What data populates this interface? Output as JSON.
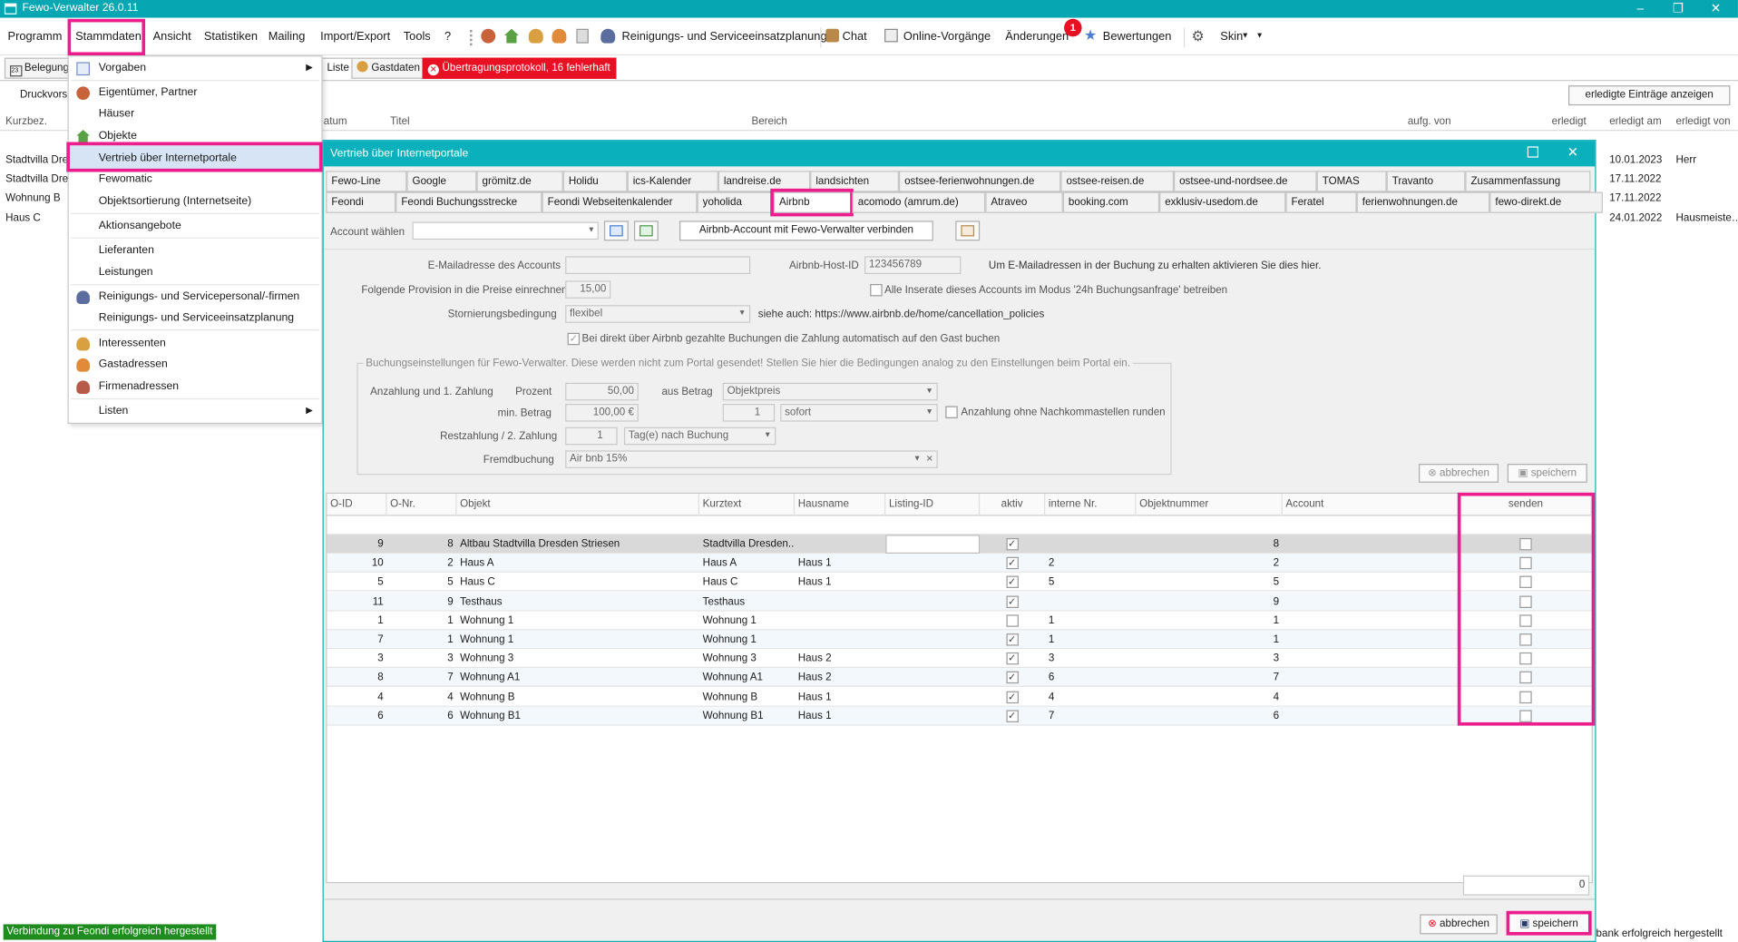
{
  "app": {
    "title": "Fewo-Verwalter 26.0.11",
    "window_controls": [
      "–",
      "❐",
      "✕"
    ]
  },
  "menu": {
    "items": [
      "Programm",
      "Stammdaten",
      "Ansicht",
      "Statistiken",
      "Mailing",
      "Import/Export",
      "Tools",
      "?"
    ],
    "reinigung": "Reinigungs- und Serviceeinsatzplanung",
    "chat": "Chat",
    "online": "Online-Vorgänge",
    "aenderungen": "Änderungen",
    "aenderungen_badge": "1",
    "bewertungen": "Bewertungen",
    "skin": "Skin"
  },
  "tabs": {
    "belegung": "Belegung",
    "liste": "Liste",
    "gastdaten": "Gastdaten",
    "protokoll": "Übertragungsprotokoll, 16 fehlerhaft"
  },
  "background": {
    "druckvorschau": "Druckvorsc",
    "erledigte_btn": "erledigte Einträge anzeigen",
    "headers": [
      "Kurzbez.",
      "atum",
      "Titel",
      "Bereich",
      "aufg. von",
      "erledigt",
      "erledigt am",
      "erledigt von"
    ],
    "rows_left": [
      "Stadtvilla Dres",
      "Stadtvilla Dres",
      "Wohnung B",
      "Haus C"
    ],
    "rows_right": [
      {
        "date": "10.01.2023",
        "by": "Herr"
      },
      {
        "date": "17.11.2022",
        "by": ""
      },
      {
        "date": "17.11.2022",
        "by": ""
      },
      {
        "date": "24.01.2022",
        "by": "Hausmeiste…"
      }
    ],
    "status_left": "Verbindung zu Feondi erfolgreich hergestellt",
    "status_right": "bank erfolgreich hergestellt"
  },
  "dropdown": {
    "items": [
      "Vorgaben",
      "Eigentümer, Partner",
      "Häuser",
      "Objekte",
      "Vertrieb über Internetportale",
      "Fewomatic",
      "Objektsortierung (Internetseite)",
      "Aktionsangebote",
      "Lieferanten",
      "Leistungen",
      "Reinigungs- und Servicepersonal/-firmen",
      "Reinigungs- und Serviceeinsatzplanung",
      "Interessenten",
      "Gastadressen",
      "Firmenadressen",
      "Listen"
    ]
  },
  "dialog": {
    "title": "Vertrieb über Internetportale",
    "portals_row1": [
      "Fewo-Line",
      "Google",
      "grömitz.de",
      "Holidu",
      "ics-Kalender",
      "landreise.de",
      "landsichten",
      "ostsee-ferienwohnungen.de",
      "ostsee-reisen.de",
      "ostsee-und-nordsee.de",
      "TOMAS",
      "Travanto",
      "Zusammenfassung"
    ],
    "portals_row2": [
      "Feondi",
      "Feondi Buchungsstrecke",
      "Feondi Webseitenkalender",
      "yoholida",
      "Airbnb",
      "acomodo (amrum.de)",
      "Atraveo",
      "booking.com",
      "exklusiv-usedom.de",
      "Feratel",
      "ferienwohnungen.de",
      "fewo-direkt.de"
    ],
    "account_label": "Account wählen",
    "account_value": "",
    "connect_btn": "Airbnb-Account mit Fewo-Verwalter verbinden",
    "email_label": "E-Mailadresse des Accounts",
    "email_value": "",
    "host_label": "Airbnb-Host-ID",
    "host_value": "123456789",
    "host_info": "Um E-Mailadressen in der Buchung zu erhalten aktivieren Sie dies hier.",
    "provision_label": "Folgende Provision in die Preise einrechnen",
    "provision_value": "15,00",
    "inserate_label": "Alle Inserate dieses Accounts im Modus '24h Buchungsanfrage' betreiben",
    "storno_label": "Stornierungsbedingung",
    "storno_value": "flexibel",
    "storno_info": "siehe auch: https://www.airbnb.de/home/cancellation_policies",
    "zahlung_label": "Bei direkt über Airbnb gezahlte Buchungen die Zahlung automatisch auf den Gast buchen",
    "group_label": "Buchungseinstellungen für Fewo-Verwalter. Diese werden nicht zum Portal gesendet! Stellen Sie hier die Bedingungen analog zu den Einstellungen beim Portal ein.",
    "anzahlung_label": "Anzahlung und 1. Zahlung",
    "prozent_label": "Prozent",
    "prozent_value": "50,00",
    "ausbetrag_label": "aus Betrag",
    "ausbetrag_value": "Objektpreis",
    "minbetrag_label": "min. Betrag",
    "minbetrag_value": "100,00 €",
    "tage_value": "1",
    "sofort_value": "sofort",
    "runden_label": "Anzahlung ohne Nachkommastellen runden",
    "rest_label": "Restzahlung / 2. Zahlung",
    "rest_value": "1",
    "rest_unit": "Tag(e) nach Buchung",
    "fremd_label": "Fremdbuchung",
    "fremd_value": "Air bnb 15%",
    "abbrechen": "abbrechen",
    "speichern": "speichern",
    "columns": [
      "O-ID",
      "O-Nr.",
      "Objekt",
      "Kurztext",
      "Hausname",
      "Listing-ID",
      "aktiv",
      "interne Nr.",
      "Objektnummer",
      "Account",
      "senden"
    ],
    "rows": [
      {
        "oid": "9",
        "onr": "8",
        "objekt": "Altbau Stadtvilla Dresden Striesen",
        "kurz": "Stadtvilla Dresden...",
        "haus": "",
        "listing": "",
        "aktiv": true,
        "intern": "",
        "objnr": "8",
        "account": "",
        "senden": false
      },
      {
        "oid": "10",
        "onr": "2",
        "objekt": "Haus A",
        "kurz": "Haus A",
        "haus": "Haus 1",
        "listing": "",
        "aktiv": true,
        "intern": "2",
        "objnr": "2",
        "account": "",
        "senden": false
      },
      {
        "oid": "5",
        "onr": "5",
        "objekt": "Haus C",
        "kurz": "Haus C",
        "haus": "Haus 1",
        "listing": "",
        "aktiv": true,
        "intern": "5",
        "objnr": "5",
        "account": "",
        "senden": false
      },
      {
        "oid": "11",
        "onr": "9",
        "objekt": "Testhaus",
        "kurz": "Testhaus",
        "haus": "",
        "listing": "",
        "aktiv": true,
        "intern": "",
        "objnr": "9",
        "account": "",
        "senden": false
      },
      {
        "oid": "1",
        "onr": "1",
        "objekt": "Wohnung 1",
        "kurz": "Wohnung 1",
        "haus": "",
        "listing": "",
        "aktiv": false,
        "intern": "1",
        "objnr": "1",
        "account": "",
        "senden": false
      },
      {
        "oid": "7",
        "onr": "1",
        "objekt": "Wohnung 1",
        "kurz": "Wohnung 1",
        "haus": "",
        "listing": "",
        "aktiv": true,
        "intern": "1",
        "objnr": "1",
        "account": "",
        "senden": false
      },
      {
        "oid": "3",
        "onr": "3",
        "objekt": "Wohnung 3",
        "kurz": "Wohnung 3",
        "haus": "Haus 2",
        "listing": "",
        "aktiv": true,
        "intern": "3",
        "objnr": "3",
        "account": "",
        "senden": false
      },
      {
        "oid": "8",
        "onr": "7",
        "objekt": "Wohnung A1",
        "kurz": "Wohnung A1",
        "haus": "Haus 2",
        "listing": "",
        "aktiv": true,
        "intern": "6",
        "objnr": "7",
        "account": "",
        "senden": false
      },
      {
        "oid": "4",
        "onr": "4",
        "objekt": "Wohnung B",
        "kurz": "Wohnung B",
        "haus": "Haus 1",
        "listing": "",
        "aktiv": true,
        "intern": "4",
        "objnr": "4",
        "account": "",
        "senden": false
      },
      {
        "oid": "6",
        "onr": "6",
        "objekt": "Wohnung B1",
        "kurz": "Wohnung B1",
        "haus": "Haus 1",
        "listing": "",
        "aktiv": true,
        "intern": "7",
        "objnr": "6",
        "account": "",
        "senden": false
      }
    ],
    "total": "0"
  },
  "colors": {
    "accent": "#06a7b3",
    "highlight": "#ec1e8d",
    "error": "#e81123",
    "success": "#1e8c1e"
  }
}
